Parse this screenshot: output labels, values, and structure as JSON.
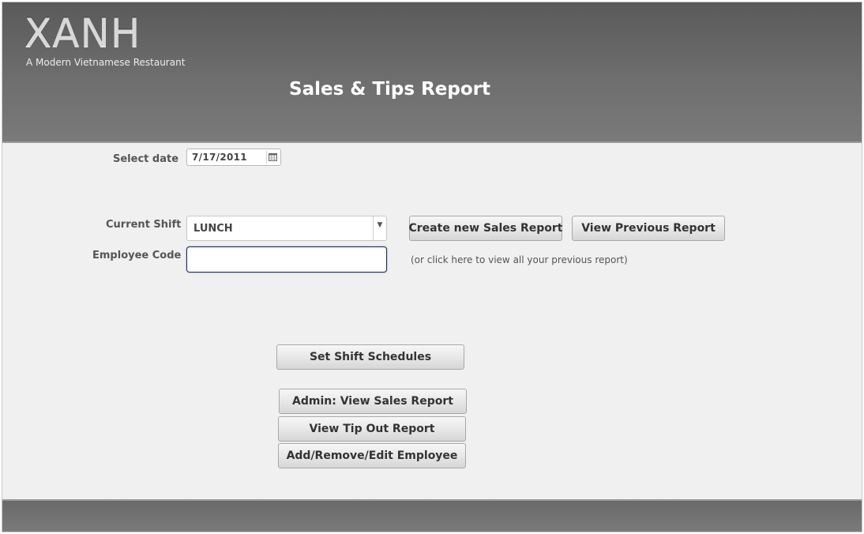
{
  "header": {
    "logo_title": "XANH",
    "logo_tagline": "A Modern Vietnamese Restaurant",
    "page_title": "Sales & Tips Report"
  },
  "form": {
    "date_label": "Select date",
    "date_value": "7/17/2011",
    "shift_label": "Current Shift",
    "shift_value": "LUNCH",
    "employee_label": "Employee Code",
    "employee_value": ""
  },
  "actions": {
    "create_report": "Create new Sales Report",
    "view_previous": "View Previous Report",
    "hint": "(or click here to view all your previous report)",
    "set_shift": "Set Shift Schedules",
    "admin_sales": "Admin: View Sales Report",
    "tip_out": "View Tip Out Report",
    "edit_employee": "Add/Remove/Edit Employee"
  },
  "icons": {
    "date_picker": "calendar-icon",
    "dropdown": "chevron-down-icon"
  },
  "colors": {
    "header_bg": "#6e6e6e",
    "content_bg": "#f0f0f0",
    "focus_border": "#1b2a5c"
  }
}
